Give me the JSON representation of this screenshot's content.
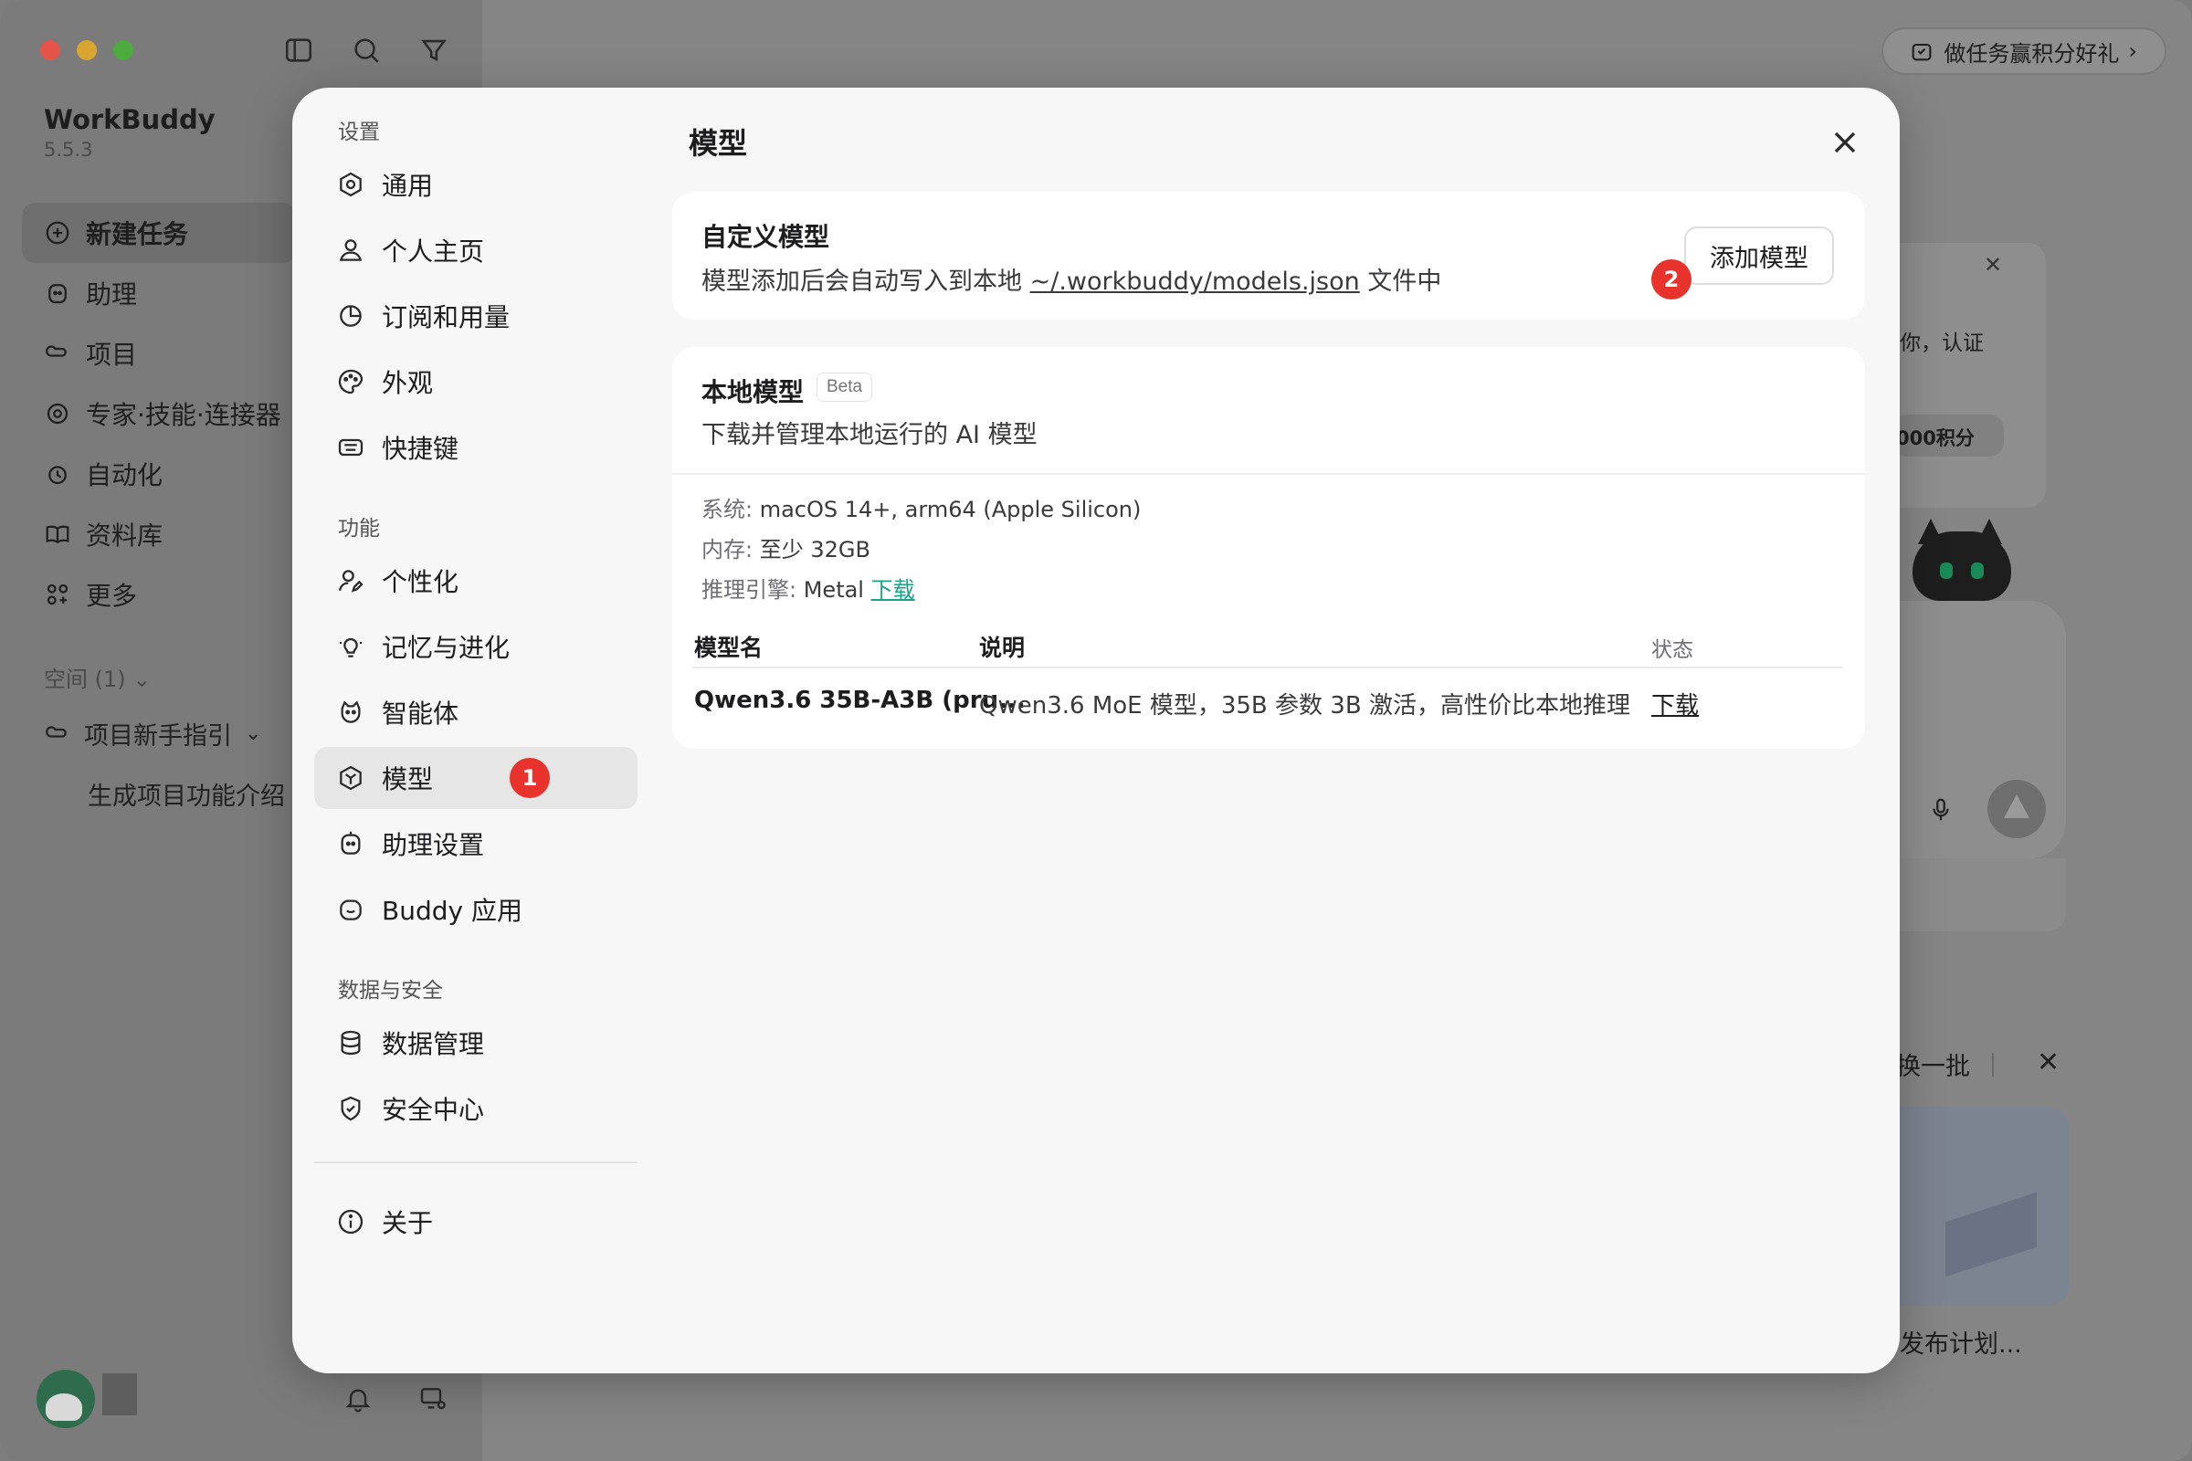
{
  "app": {
    "brand": "WorkBuddy",
    "version": "5.5.3",
    "nav": [
      {
        "label": "新建任务",
        "icon": "plus-circle-icon"
      },
      {
        "label": "助理",
        "icon": "assistant-icon"
      },
      {
        "label": "项目",
        "icon": "project-icon"
      },
      {
        "label": "专家·技能·连接器",
        "icon": "expert-icon"
      },
      {
        "label": "自动化",
        "icon": "alarm-icon"
      },
      {
        "label": "资料库",
        "icon": "book-icon"
      },
      {
        "label": "更多",
        "icon": "grid-plus-icon"
      }
    ],
    "space_label": "空间 (1)",
    "project_guide": "项目新手指引",
    "project_sub": "生成项目功能介绍",
    "reward": "做任务赢积分好礼",
    "bg_card_text": "你，认证",
    "bg_card_pill": "000积分",
    "refresh": "换一批",
    "thumb_caption": "发布计划..."
  },
  "modal": {
    "title": "模型",
    "nav_groups": [
      {
        "label": "设置",
        "items": [
          {
            "label": "通用",
            "icon": "settings-icon"
          },
          {
            "label": "个人主页",
            "icon": "user-icon"
          },
          {
            "label": "订阅和用量",
            "icon": "pie-chart-icon"
          },
          {
            "label": "外观",
            "icon": "palette-icon"
          },
          {
            "label": "快捷键",
            "icon": "keyboard-icon"
          }
        ]
      },
      {
        "label": "功能",
        "items": [
          {
            "label": "个性化",
            "icon": "user-edit-icon"
          },
          {
            "label": "记忆与进化",
            "icon": "lightbulb-icon"
          },
          {
            "label": "智能体",
            "icon": "agent-icon"
          },
          {
            "label": "模型",
            "icon": "model-icon",
            "active": true,
            "badge": "1"
          },
          {
            "label": "助理设置",
            "icon": "assistant-icon"
          },
          {
            "label": "Buddy 应用",
            "icon": "buddy-icon"
          }
        ]
      },
      {
        "label": "数据与安全",
        "items": [
          {
            "label": "数据管理",
            "icon": "database-icon"
          },
          {
            "label": "安全中心",
            "icon": "shield-icon"
          }
        ]
      }
    ],
    "about": "关于",
    "custom": {
      "title": "自定义模型",
      "desc_prefix": "模型添加后会自动写入到本地 ",
      "path": "~/.workbuddy/models.json",
      "desc_suffix": " 文件中",
      "add_button": "添加模型",
      "badge": "2"
    },
    "local": {
      "title": "本地模型",
      "tag": "Beta",
      "desc": "下载并管理本地运行的 AI 模型",
      "system_key": "系统: ",
      "system_val": "macOS 14+, arm64 (Apple Silicon)",
      "memory_key": "内存: ",
      "memory_val": "至少 32GB",
      "engine_key": "推理引擎: ",
      "engine_val": "Metal ",
      "engine_link": "下载",
      "table": {
        "headers": [
          "模型名",
          "说明",
          "状态"
        ],
        "rows": [
          {
            "name": "Qwen3.6 35B-A3B (pru...",
            "desc": "Qwen3.6 MoE 模型，35B 参数 3B 激活，高性价比本地推理",
            "status": "下载"
          }
        ]
      }
    }
  }
}
